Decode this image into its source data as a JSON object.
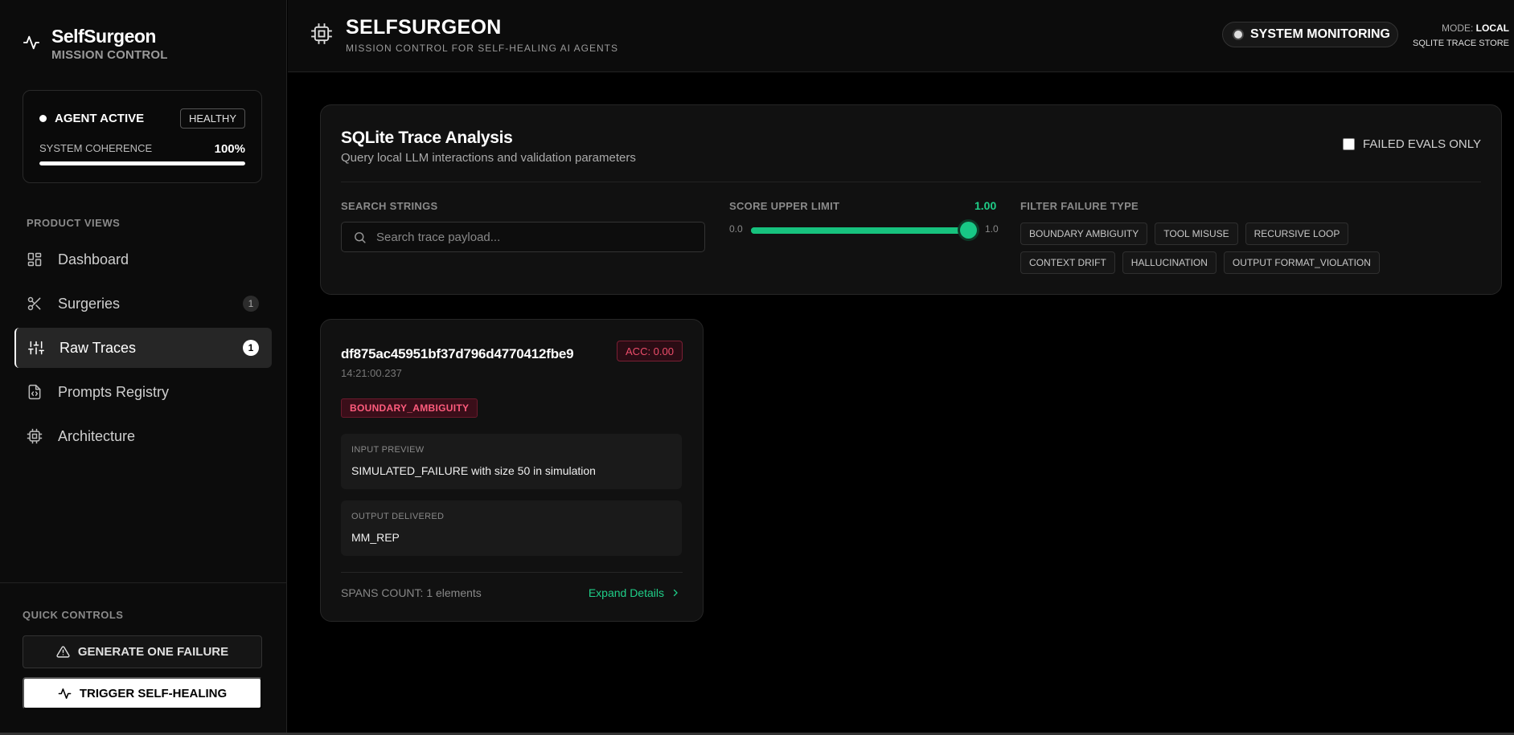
{
  "brand": {
    "name": "SelfSurgeon",
    "subtitle": "MISSION CONTROL"
  },
  "status": {
    "agent_label": "AGENT ACTIVE",
    "health_badge": "HEALTHY",
    "coherence_label": "SYSTEM COHERENCE",
    "coherence_value": "100%",
    "coherence_fraction": 1.0
  },
  "nav": {
    "section_label": "PRODUCT VIEWS",
    "items": [
      {
        "label": "Dashboard",
        "icon": "dashboard-icon",
        "count": ""
      },
      {
        "label": "Surgeries",
        "icon": "scissors-icon",
        "count": "1"
      },
      {
        "label": "Raw Traces",
        "icon": "sliders-icon",
        "count": "1",
        "active": true
      },
      {
        "label": "Prompts Registry",
        "icon": "file-code-icon",
        "count": ""
      },
      {
        "label": "Architecture",
        "icon": "cpu-icon",
        "count": ""
      }
    ]
  },
  "quick": {
    "section_label": "QUICK CONTROLS",
    "generate_label": "GENERATE ONE FAILURE",
    "heal_label": "TRIGGER SELF-HEALING"
  },
  "header": {
    "title": "SELFSURGEON",
    "subtitle": "MISSION CONTROL FOR SELF-HEALING AI AGENTS",
    "monitor_label": "SYSTEM MONITORING",
    "mode_label": "MODE:",
    "mode_value": "LOCAL",
    "store_label": "SQLITE TRACE STORE"
  },
  "analysis": {
    "title": "SQLite Trace Analysis",
    "subtitle": "Query local LLM interactions and validation parameters",
    "failed_only_label": "FAILED EVALS ONLY",
    "search_label": "SEARCH STRINGS",
    "search_placeholder": "Search trace payload...",
    "score_label": "SCORE UPPER LIMIT",
    "score_value": "1.00",
    "score_min": "0.0",
    "score_max": "1.0",
    "score_fraction": 1.0,
    "filter_label": "FILTER FAILURE TYPE",
    "chips": [
      "BOUNDARY AMBIGUITY",
      "TOOL MISUSE",
      "RECURSIVE LOOP",
      "CONTEXT DRIFT",
      "HALLUCINATION",
      "OUTPUT FORMAT_VIOLATION"
    ]
  },
  "trace": {
    "id": "df875ac45951bf37d796d4770412fbe9",
    "time": "14:21:00.237",
    "acc": "ACC: 0.00",
    "failure_type": "BOUNDARY_AMBIGUITY",
    "input_label": "INPUT PREVIEW",
    "input_value": "SIMULATED_FAILURE with size 50 in simulation",
    "output_label": "OUTPUT DELIVERED",
    "output_value": "MM_REP",
    "spans": "SPANS COUNT: 1 elements",
    "expand_label": "Expand Details"
  },
  "colors": {
    "accent": "#1fce88",
    "danger": "#ee4d6b",
    "bg": "#000000",
    "panel": "#111111"
  }
}
